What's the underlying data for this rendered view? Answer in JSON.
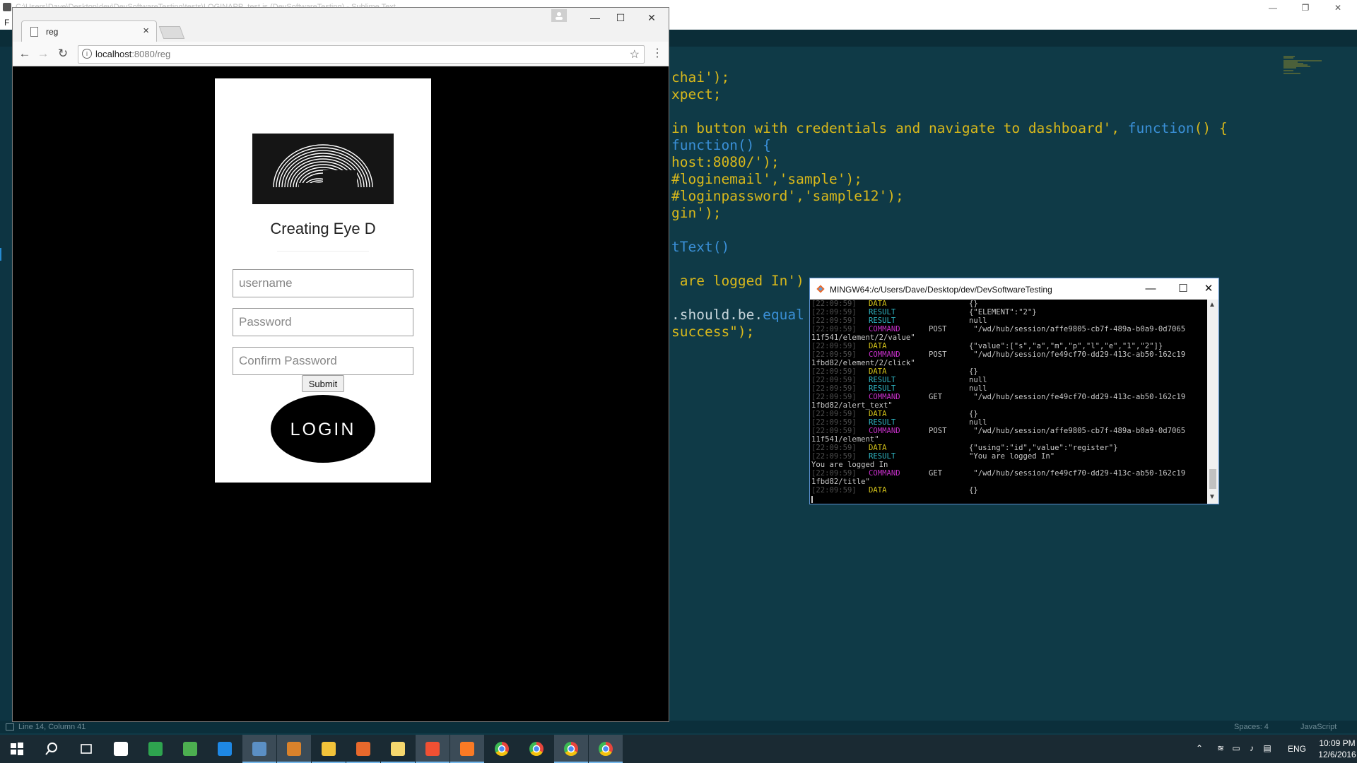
{
  "editor": {
    "title": "C:\\Users\\Dave\\Desktop\\dev\\DevSoftwareTesting\\tests\\LOGINAPP_test.js (DevSoftwareTesting) - Sublime Text",
    "menu_first": "F",
    "code_lines": [
      "chai');",
      "xpect;",
      "",
      "in button with credentials and navigate to dashboard', function() {",
      "function() {",
      "host:8080/');",
      "#loginemail','sample');",
      "#loginpassword','sample12');",
      "gin');",
      "",
      "tText()",
      "",
      " are logged In')",
      "",
      ".should.be.equal",
      "success\");"
    ],
    "status_left": "Line 14, Column 41",
    "status_spaces": "Spaces: 4",
    "status_lang": "JavaScript"
  },
  "chrome": {
    "tab_title": "reg",
    "tab_close": "×",
    "url_host": "localhost",
    "url_path": ":8080/reg",
    "minimize": "—",
    "maximize": "☐",
    "close": "✕"
  },
  "page": {
    "title": "Creating Eye D",
    "username_placeholder": "username",
    "password_placeholder": "Password",
    "confirm_placeholder": "Confirm Password",
    "submit_label": "Submit",
    "login_label": "LOGIN"
  },
  "terminal": {
    "title": "MINGW64:/c/Users/Dave/Desktop/dev/DevSoftwareTesting",
    "lines": [
      {
        "ts": "[22:09:59]",
        "type": "DATA",
        "method": "",
        "value": "{}"
      },
      {
        "ts": "[22:09:59]",
        "type": "RESULT",
        "method": "",
        "value": "{\"ELEMENT\":\"2\"}"
      },
      {
        "ts": "[22:09:59]",
        "type": "RESULT",
        "method": "",
        "value": "null"
      },
      {
        "ts": "[22:09:59]",
        "type": "COMMAND",
        "method": "POST",
        "value": " \"/wd/hub/session/affe9805-cb7f-489a-b0a9-0d7065"
      },
      {
        "full": "11f541/element/2/value\""
      },
      {
        "ts": "[22:09:59]",
        "type": "DATA",
        "method": "",
        "value": "{\"value\":[\"s\",\"a\",\"m\",\"p\",\"l\",\"e\",\"1\",\"2\"]}"
      },
      {
        "ts": "[22:09:59]",
        "type": "COMMAND",
        "method": "POST",
        "value": " \"/wd/hub/session/fe49cf70-dd29-413c-ab50-162c19"
      },
      {
        "full": "1fbd82/element/2/click\""
      },
      {
        "ts": "[22:09:59]",
        "type": "DATA",
        "method": "",
        "value": "{}"
      },
      {
        "ts": "[22:09:59]",
        "type": "RESULT",
        "method": "",
        "value": "null"
      },
      {
        "ts": "[22:09:59]",
        "type": "RESULT",
        "method": "",
        "value": "null"
      },
      {
        "ts": "[22:09:59]",
        "type": "COMMAND",
        "method": "GET",
        "value": " \"/wd/hub/session/fe49cf70-dd29-413c-ab50-162c19"
      },
      {
        "full": "1fbd82/alert_text\""
      },
      {
        "ts": "[22:09:59]",
        "type": "DATA",
        "method": "",
        "value": "{}"
      },
      {
        "ts": "[22:09:59]",
        "type": "RESULT",
        "method": "",
        "value": "null"
      },
      {
        "ts": "[22:09:59]",
        "type": "COMMAND",
        "method": "POST",
        "value": " \"/wd/hub/session/affe9805-cb7f-489a-b0a9-0d7065"
      },
      {
        "full": "11f541/element\""
      },
      {
        "ts": "[22:09:59]",
        "type": "DATA",
        "method": "",
        "value": "{\"using\":\"id\",\"value\":\"register\"}"
      },
      {
        "ts": "[22:09:59]",
        "type": "RESULT",
        "method": "",
        "value": "\"You are logged In\""
      },
      {
        "full": "You are logged In"
      },
      {
        "ts": "[22:09:59]",
        "type": "COMMAND",
        "method": "GET",
        "value": " \"/wd/hub/session/fe49cf70-dd29-413c-ab50-162c19"
      },
      {
        "full": "1fbd82/title\""
      },
      {
        "ts": "[22:09:59]",
        "type": "DATA",
        "method": "",
        "value": "{}"
      }
    ],
    "minimize": "—",
    "maximize": "☐",
    "close": "✕"
  },
  "taskbar": {
    "apps": [
      {
        "name": "start-button",
        "color": "#ffffff"
      },
      {
        "name": "search-icon",
        "color": "#ffffff"
      },
      {
        "name": "task-view-icon",
        "color": "#ffffff"
      },
      {
        "name": "store-icon",
        "color": "#ffffff"
      },
      {
        "name": "notepad-app-icon",
        "color": "#2ea44f"
      },
      {
        "name": "image-app-icon",
        "color": "#4caf50"
      },
      {
        "name": "edge-icon",
        "color": "#1e88e5"
      },
      {
        "name": "steam-icon",
        "color": "#5b8fc4"
      },
      {
        "name": "sublime-icon",
        "color": "#d9822b"
      },
      {
        "name": "file-explorer-icon",
        "color": "#f2c33a"
      },
      {
        "name": "firefox-icon",
        "color": "#e8692c"
      },
      {
        "name": "folder-icon",
        "color": "#f5d76e"
      },
      {
        "name": "git-icon",
        "color": "#f05033"
      },
      {
        "name": "xampp-icon",
        "color": "#fb7a24"
      },
      {
        "name": "chrome-icon",
        "color": "#e8453c"
      },
      {
        "name": "chrome-icon",
        "color": "#e8453c"
      },
      {
        "name": "chrome-icon",
        "color": "#e8453c"
      },
      {
        "name": "chrome-icon",
        "color": "#e8453c"
      }
    ],
    "lang": "ENG",
    "time": "10:09 PM",
    "date": "12/6/2016"
  }
}
